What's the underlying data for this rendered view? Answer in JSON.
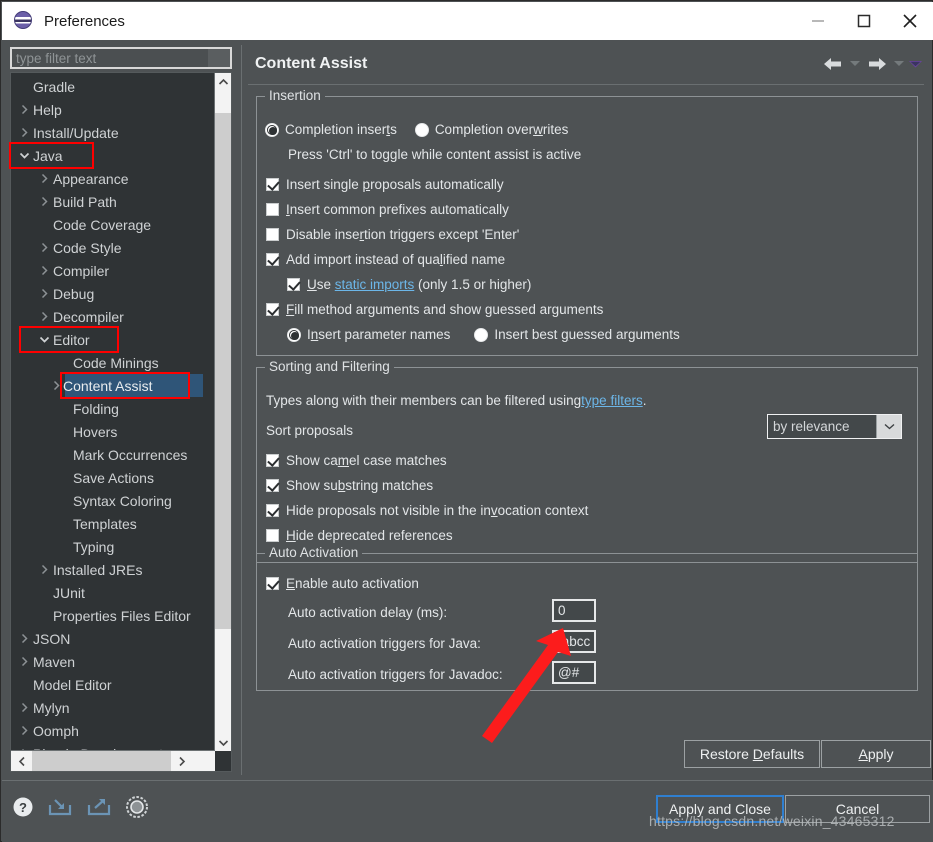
{
  "window": {
    "title": "Preferences",
    "minimize_label": "Minimize",
    "maximize_label": "Maximize",
    "close_label": "Close"
  },
  "sidebar": {
    "filter_placeholder": "type filter text",
    "items": [
      {
        "label": "Gradle",
        "depth": 0,
        "arrow": "none"
      },
      {
        "label": "Help",
        "depth": 0,
        "arrow": "right"
      },
      {
        "label": "Install/Update",
        "depth": 0,
        "arrow": "right"
      },
      {
        "label": "Java",
        "depth": 0,
        "arrow": "down"
      },
      {
        "label": "Appearance",
        "depth": 1,
        "arrow": "right"
      },
      {
        "label": "Build Path",
        "depth": 1,
        "arrow": "right"
      },
      {
        "label": "Code Coverage",
        "depth": 1,
        "arrow": "none"
      },
      {
        "label": "Code Style",
        "depth": 1,
        "arrow": "right"
      },
      {
        "label": "Compiler",
        "depth": 1,
        "arrow": "right"
      },
      {
        "label": "Debug",
        "depth": 1,
        "arrow": "right"
      },
      {
        "label": "Decompiler",
        "depth": 1,
        "arrow": "right"
      },
      {
        "label": "Editor",
        "depth": 1,
        "arrow": "down"
      },
      {
        "label": "Code Minings",
        "depth": 2,
        "arrow": "none"
      },
      {
        "label": "Content Assist",
        "depth": 2,
        "arrow": "right",
        "selected": true
      },
      {
        "label": "Folding",
        "depth": 2,
        "arrow": "none"
      },
      {
        "label": "Hovers",
        "depth": 2,
        "arrow": "none"
      },
      {
        "label": "Mark Occurrences",
        "depth": 2,
        "arrow": "none"
      },
      {
        "label": "Save Actions",
        "depth": 2,
        "arrow": "none"
      },
      {
        "label": "Syntax Coloring",
        "depth": 2,
        "arrow": "none"
      },
      {
        "label": "Templates",
        "depth": 2,
        "arrow": "none"
      },
      {
        "label": "Typing",
        "depth": 2,
        "arrow": "none"
      },
      {
        "label": "Installed JREs",
        "depth": 1,
        "arrow": "right"
      },
      {
        "label": "JUnit",
        "depth": 1,
        "arrow": "none"
      },
      {
        "label": "Properties Files Editor",
        "depth": 1,
        "arrow": "none"
      },
      {
        "label": "JSON",
        "depth": 0,
        "arrow": "right"
      },
      {
        "label": "Maven",
        "depth": 0,
        "arrow": "right"
      },
      {
        "label": "Model Editor",
        "depth": 0,
        "arrow": "none"
      },
      {
        "label": "Mylyn",
        "depth": 0,
        "arrow": "right"
      },
      {
        "label": "Oomph",
        "depth": 0,
        "arrow": "right"
      },
      {
        "label": "Plug-in Development",
        "depth": 0,
        "arrow": "right"
      }
    ]
  },
  "page": {
    "title": "Content Assist",
    "nav_back_label": "Back",
    "nav_forward_label": "Forward",
    "view_menu_label": "View Menu"
  },
  "insertion": {
    "legend": "Insertion",
    "radio_inserts": {
      "label": "Completion inserts",
      "underline": "t",
      "selected": true
    },
    "radio_overwrites": {
      "label": "Completion overwrites",
      "underline": "w",
      "selected": false
    },
    "hint": "Press 'Ctrl' to toggle while content assist is active",
    "checks": [
      {
        "label": "Insert single proposals automatically",
        "checked": true
      },
      {
        "label": "Insert common prefixes automatically",
        "checked": false
      },
      {
        "label": "Disable insertion triggers except 'Enter'",
        "checked": false
      },
      {
        "label": "Add import instead of qualified name",
        "checked": true
      }
    ],
    "static_imports": {
      "prefix": "Use ",
      "link": "static imports",
      "suffix": " (only 1.5 or higher)",
      "checked": true
    },
    "fill_method": {
      "label": "Fill method arguments and show guessed arguments",
      "checked": true
    },
    "radio_param_names": {
      "label": "Insert parameter names",
      "selected": true
    },
    "radio_best_guessed": {
      "label": "Insert best guessed arguments",
      "selected": false
    }
  },
  "sorting": {
    "legend": "Sorting and Filtering",
    "filter_text_prefix": "Types along with their members can be filtered using ",
    "filter_link": "type filters",
    "filter_text_suffix": ".",
    "sort_label": "Sort proposals",
    "sort_value": "by relevance",
    "checks": [
      {
        "label": "Show camel case matches",
        "checked": true
      },
      {
        "label": "Show substring matches",
        "checked": true
      },
      {
        "label": "Hide proposals not visible in the invocation context",
        "checked": true
      },
      {
        "label": "Hide deprecated references",
        "checked": false
      }
    ]
  },
  "auto_activation": {
    "legend": "Auto Activation",
    "enable": {
      "label": "Enable auto activation",
      "checked": true
    },
    "fields": [
      {
        "label": "Auto activation delay (ms):",
        "value": "0"
      },
      {
        "label": "Auto activation triggers for Java:",
        "value": ".abcc"
      },
      {
        "label": "Auto activation triggers for Javadoc:",
        "value": "@#"
      }
    ]
  },
  "buttons": {
    "restore_defaults": "Restore Defaults",
    "apply": "Apply",
    "apply_and_close": "Apply and Close",
    "cancel": "Cancel"
  },
  "bottom_icons": [
    {
      "name": "help-icon",
      "title": "Help"
    },
    {
      "name": "import-icon",
      "title": "Import"
    },
    {
      "name": "export-icon",
      "title": "Export"
    },
    {
      "name": "settings-icon",
      "title": "Settings"
    }
  ],
  "watermark": "https://blog.csdn.net/weixin_43465312",
  "colors": {
    "window_bg": "#4e5254",
    "tree_bg": "#2f3335",
    "selection": "#2f5578",
    "link": "#6cb6e8",
    "annotation_red": "#ff0000",
    "primary_border": "#2f7fd0"
  }
}
